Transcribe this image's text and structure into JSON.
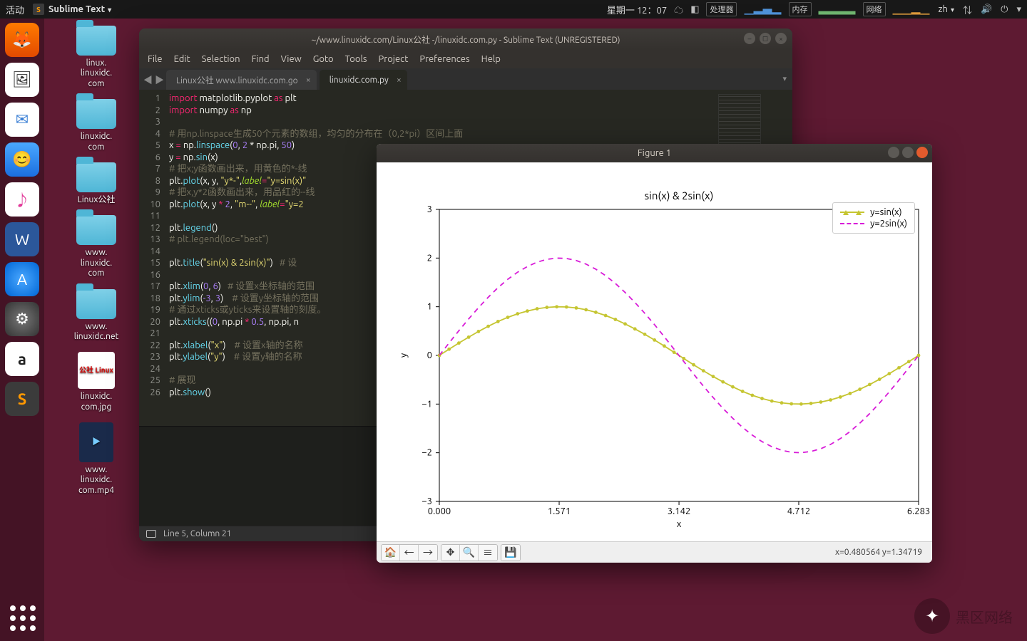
{
  "top_panel": {
    "activities": "活动",
    "app_name": "Sublime Text",
    "clock": "星期一  12：07",
    "ind1": "处理器",
    "ind2": "内存",
    "ind3": "网络",
    "lang": "zh"
  },
  "desktop_icons": [
    {
      "name": "linux.\nlinuxidc.\ncom",
      "type": "folder"
    },
    {
      "name": "linuxidc.\ncom",
      "type": "folder"
    },
    {
      "name": "Linux公社",
      "type": "folder"
    },
    {
      "name": "www.\nlinuxidc.\ncom",
      "type": "folder"
    },
    {
      "name": "www.\nlinuxidc.net",
      "type": "folder"
    },
    {
      "name": "linuxidc.\ncom.jpg",
      "type": "jpg"
    },
    {
      "name": "www.\nlinuxidc.\ncom.mp4",
      "type": "mp4"
    }
  ],
  "sublime": {
    "title": "~/www.linuxidc.com/Linux公社 -/linuxidc.com.py - Sublime Text (UNREGISTERED)",
    "menus": [
      "File",
      "Edit",
      "Selection",
      "Find",
      "View",
      "Goto",
      "Tools",
      "Project",
      "Preferences",
      "Help"
    ],
    "tabs": [
      {
        "label": "Linux公社 www.linuxidc.com.go",
        "active": false
      },
      {
        "label": "linuxidc.com.py",
        "active": true
      }
    ],
    "status": "Line 5, Column 21",
    "lines": [
      1,
      2,
      3,
      4,
      5,
      6,
      7,
      8,
      9,
      10,
      11,
      12,
      13,
      14,
      15,
      16,
      17,
      18,
      19,
      20,
      21,
      22,
      23,
      24,
      25,
      26
    ]
  },
  "code_text": {
    "l1a": "import",
    "l1b": " matplotlib.pyplot ",
    "l1c": "as",
    "l1d": " plt",
    "l2a": "import",
    "l2b": " numpy ",
    "l2c": "as",
    "l2d": " np",
    "l4": "# 用np.linspace生成50个元素的数组，均匀的分布在（0,2*pi）区间上面",
    "l5a": "x ",
    "l5b": "=",
    "l5c": " np.",
    "l5d": "linspace",
    "l5e": "(",
    "l5f": "0",
    "l5g": ", ",
    "l5h": "2",
    "l5i": " * np.pi, ",
    "l5j": "50",
    "l5k": ")",
    "l6a": "y ",
    "l6b": "=",
    "l6c": " np.",
    "l6d": "sin",
    "l6e": "(x)",
    "l7": "# 把x;y函数画出来，用黄色的*-线",
    "l8a": "plt.",
    "l8b": "plot",
    "l8c": "(x, y, ",
    "l8d": "\"y*-\"",
    "l8e": ",",
    "l8f": "label",
    "l8g": "=",
    "l8h": "\"y=sin(x)\"",
    "l9": "# 把x,y*2函数画出来，用品红的--线",
    "l10a": "plt.",
    "l10b": "plot",
    "l10c": "(x, y ",
    "l10d": "*",
    "l10e": " ",
    "l10f": "2",
    "l10g": ", ",
    "l10h": "\"m--\"",
    "l10i": ", ",
    "l10j": "label",
    "l10k": "=",
    "l10l": "\"y=2",
    "l12a": "plt.",
    "l12b": "legend",
    "l12c": "()",
    "l13": "# plt.legend(loc=\"best\")",
    "l15a": "plt.",
    "l15b": "title",
    "l15c": "(",
    "l15d": "\"sin(x) & 2sin(x)\"",
    "l15e": ")   ",
    "l15f": "# 设",
    "l17a": "plt.",
    "l17b": "xlim",
    "l17c": "(",
    "l17d": "0",
    "l17e": ", ",
    "l17f": "6",
    "l17g": ")   ",
    "l17h": "# 设置x坐标轴的范围",
    "l18a": "plt.",
    "l18b": "ylim",
    "l18c": "(",
    "l18d": "-3",
    "l18e": ", ",
    "l18f": "3",
    "l18g": ")    ",
    "l18h": "# 设置y坐标轴的范围",
    "l19": "# 通过xticks或yticks来设置轴的刻度。",
    "l20a": "plt.",
    "l20b": "xticks",
    "l20c": "((",
    "l20d": "0",
    "l20e": ", np.pi ",
    "l20f": "*",
    "l20g": " ",
    "l20h": "0.5",
    "l20i": ", np.pi, n",
    "l22a": "plt.",
    "l22b": "xlabel",
    "l22c": "(",
    "l22d": "\"x\"",
    "l22e": ")    ",
    "l22f": "# 设置x轴的名称",
    "l23a": "plt.",
    "l23b": "ylabel",
    "l23c": "(",
    "l23d": "\"y\"",
    "l23e": ")    ",
    "l23f": "# 设置y轴的名称",
    "l25": "# 展现",
    "l26a": "plt.",
    "l26b": "show",
    "l26c": "()"
  },
  "figure": {
    "title": "Figure 1",
    "coords": "x=0.480564   y=1.34719"
  },
  "chart_data": {
    "type": "line",
    "title": "sin(x) & 2sin(x)",
    "xlabel": "x",
    "ylabel": "y",
    "xlim": [
      0,
      6.283
    ],
    "ylim": [
      -3,
      3
    ],
    "xticks": [
      0.0,
      1.571,
      3.142,
      4.712,
      6.283
    ],
    "yticks": [
      -3,
      -2,
      -1,
      0,
      1,
      2,
      3
    ],
    "series": [
      {
        "name": "y=sin(x)",
        "style": "y*-",
        "color": "#c5c531",
        "x": [
          0.0,
          0.128,
          0.256,
          0.385,
          0.513,
          0.641,
          0.769,
          0.897,
          1.026,
          1.154,
          1.282,
          1.41,
          1.539,
          1.667,
          1.795,
          1.923,
          2.051,
          2.18,
          2.308,
          2.436,
          2.564,
          2.693,
          2.821,
          2.949,
          3.077,
          3.205,
          3.334,
          3.462,
          3.59,
          3.718,
          3.847,
          3.975,
          4.103,
          4.231,
          4.359,
          4.488,
          4.616,
          4.744,
          4.872,
          5.001,
          5.129,
          5.257,
          5.385,
          5.513,
          5.642,
          5.77,
          5.898,
          6.026,
          6.155,
          6.283
        ],
        "y": [
          0.0,
          0.128,
          0.254,
          0.375,
          0.491,
          0.598,
          0.696,
          0.782,
          0.855,
          0.912,
          0.958,
          0.987,
          0.999,
          0.995,
          0.975,
          0.938,
          0.886,
          0.819,
          0.739,
          0.647,
          0.544,
          0.434,
          0.316,
          0.193,
          0.064,
          -0.064,
          -0.193,
          -0.316,
          -0.434,
          -0.544,
          -0.647,
          -0.739,
          -0.819,
          -0.886,
          -0.938,
          -0.975,
          -0.995,
          -0.999,
          -0.987,
          -0.958,
          -0.915,
          -0.855,
          -0.782,
          -0.696,
          -0.598,
          -0.491,
          -0.375,
          -0.254,
          -0.128,
          0.0
        ]
      },
      {
        "name": "y=2sin(x)",
        "style": "m--",
        "color": "#d81bd8",
        "x": [
          0.0,
          0.128,
          0.256,
          0.385,
          0.513,
          0.641,
          0.769,
          0.897,
          1.026,
          1.154,
          1.282,
          1.41,
          1.539,
          1.667,
          1.795,
          1.923,
          2.051,
          2.18,
          2.308,
          2.436,
          2.564,
          2.693,
          2.821,
          2.949,
          3.077,
          3.205,
          3.334,
          3.462,
          3.59,
          3.718,
          3.847,
          3.975,
          4.103,
          4.231,
          4.359,
          4.488,
          4.616,
          4.744,
          4.872,
          5.001,
          5.129,
          5.257,
          5.385,
          5.513,
          5.642,
          5.77,
          5.898,
          6.026,
          6.155,
          6.283
        ],
        "y": [
          0.0,
          0.256,
          0.508,
          0.751,
          0.981,
          1.196,
          1.391,
          1.563,
          1.709,
          1.825,
          1.915,
          1.974,
          1.999,
          1.991,
          1.949,
          1.876,
          1.772,
          1.638,
          1.478,
          1.294,
          1.089,
          0.867,
          0.632,
          0.385,
          0.128,
          -0.128,
          -0.385,
          -0.632,
          -0.867,
          -1.089,
          -1.294,
          -1.478,
          -1.638,
          -1.772,
          -1.876,
          -1.949,
          -1.991,
          -1.999,
          -1.974,
          -1.917,
          -1.829,
          -1.709,
          -1.563,
          -1.391,
          -1.196,
          -0.981,
          -0.751,
          -0.508,
          -0.256,
          0.0
        ]
      }
    ],
    "legend": [
      "y=sin(x)",
      "y=2sin(x)"
    ]
  },
  "watermark": "黑区网络"
}
